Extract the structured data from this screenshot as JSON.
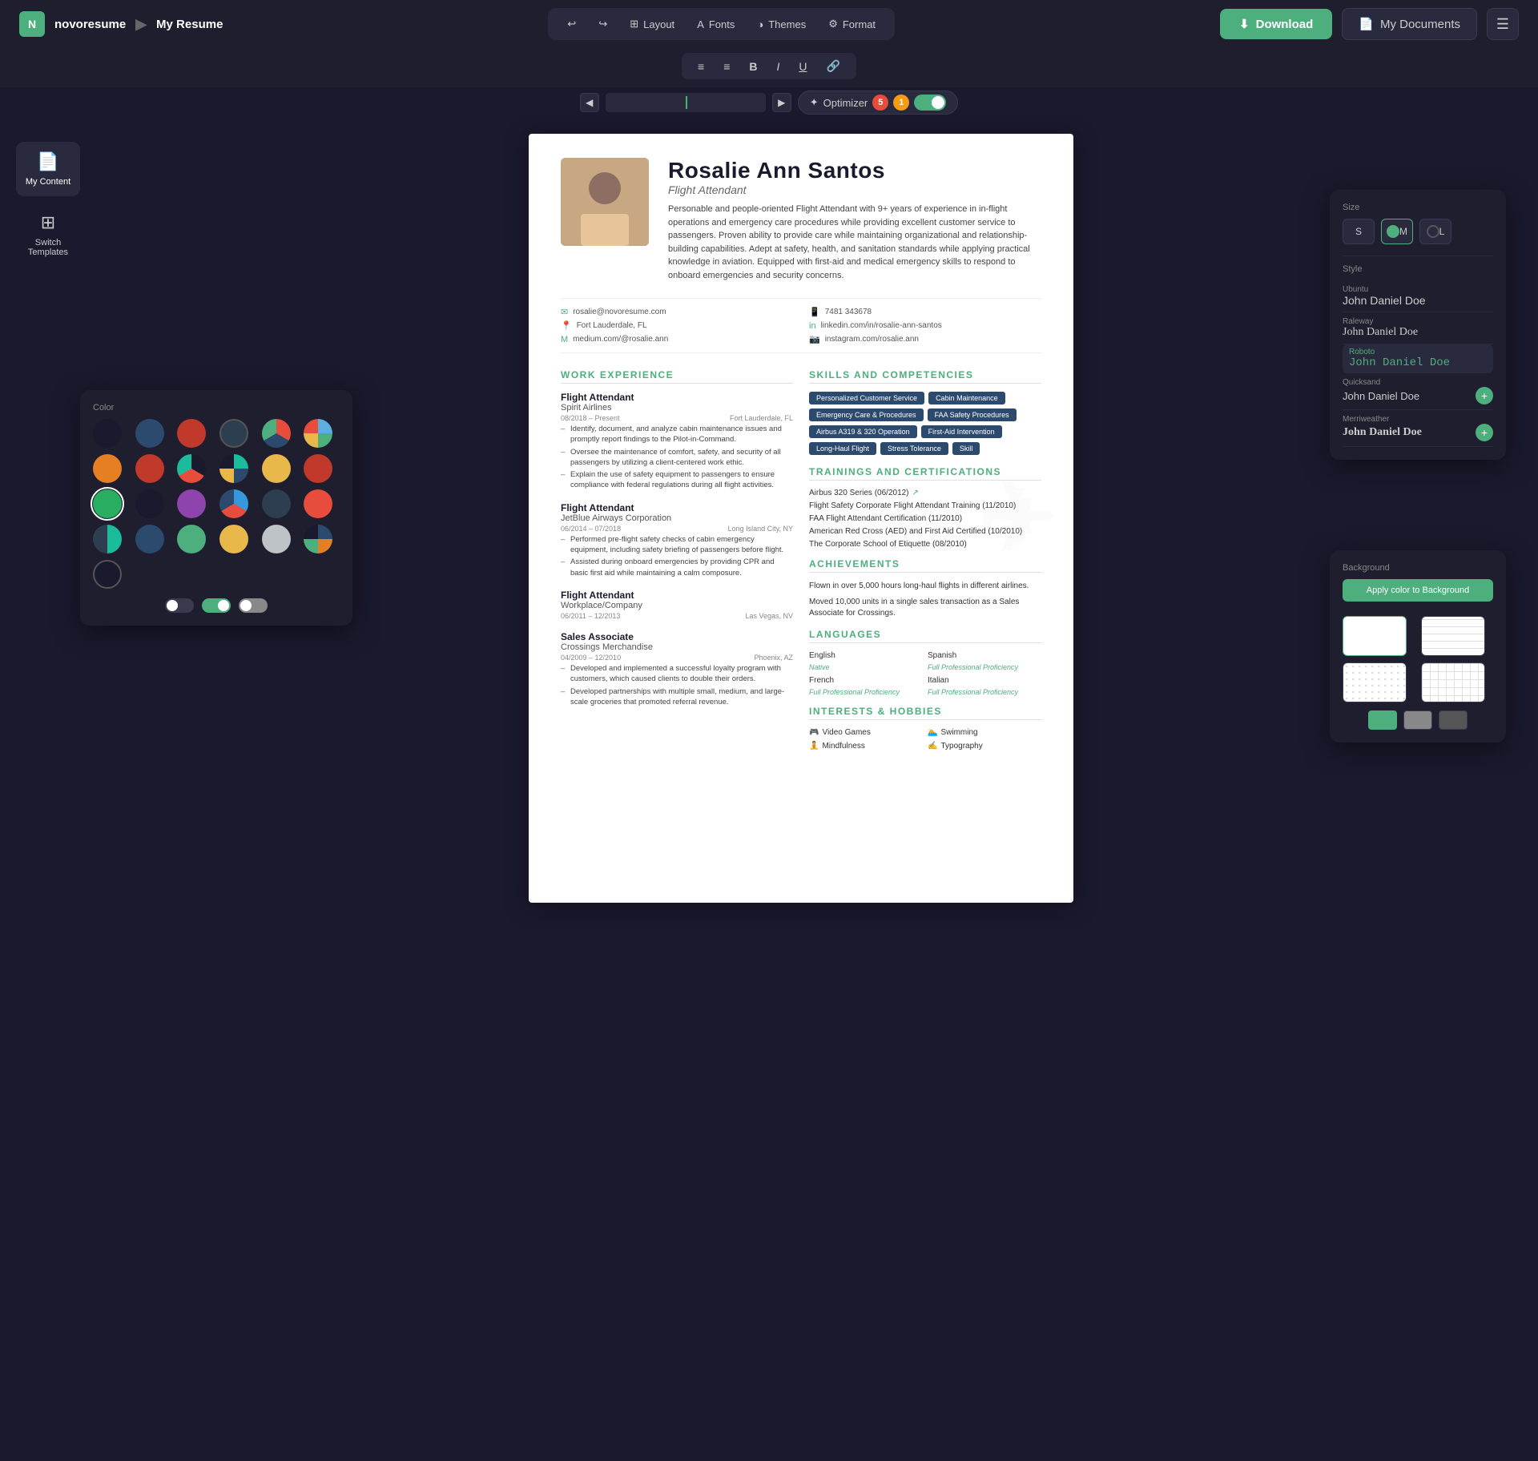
{
  "brand": {
    "logo": "N",
    "app_name": "novoresume",
    "doc_name": "My Resume",
    "sep": "▶"
  },
  "top_nav": {
    "undo_label": "↩",
    "redo_label": "↪",
    "layout_label": "Layout",
    "fonts_label": "Fonts",
    "themes_label": "Themes",
    "format_label": "Format",
    "download_label": "Download",
    "my_docs_label": "My Documents"
  },
  "format_bar": {
    "align_left": "≡",
    "align_center": "≡",
    "bold": "B",
    "italic": "I",
    "underline": "U",
    "link": "🔗"
  },
  "optimizer": {
    "label": "Optimizer",
    "badge_red": "5",
    "badge_orange": "1"
  },
  "sidebar": {
    "items": [
      {
        "id": "my-content",
        "icon": "📄",
        "label": "My Content"
      },
      {
        "id": "switch-templates",
        "icon": "⊞",
        "label": "Switch Templates"
      }
    ]
  },
  "resume": {
    "name": "Rosalie Ann Santos",
    "title": "Flight Attendant",
    "summary": "Personable and people-oriented Flight Attendant with 9+ years of experience in in-flight operations and emergency care procedures while providing excellent customer service to passengers. Proven ability to provide care while maintaining organizational and relationship-building capabilities. Adept at safety, health, and sanitation standards while applying practical knowledge in aviation. Equipped with first-aid and medical emergency skills to respond to onboard emergencies and security concerns.",
    "contact": {
      "email": "rosalie@novoresume.com",
      "phone": "7481 343678",
      "location": "Fort Lauderdale, FL",
      "linkedin": "linkedin.com/in/rosalie-ann-santos",
      "medium": "medium.com/@rosalie.ann",
      "instagram": "instagram.com/rosalie.ann"
    },
    "work_experience": {
      "title": "WORK EXPERIENCE",
      "jobs": [
        {
          "role": "Flight Attendant",
          "company": "Spirit Airlines",
          "dates": "08/2018 – Present",
          "location": "Fort Lauderdale, FL",
          "bullets": [
            "Identify, document, and analyze cabin maintenance issues and promptly report findings to the Pilot-in-Command.",
            "Oversee the maintenance of comfort, safety, and security of all passengers by utilizing a client-centered work ethic.",
            "Explain the use of safety equipment to passengers to ensure compliance with federal regulations during all flight activities."
          ]
        },
        {
          "role": "Flight Attendant",
          "company": "JetBlue Airways Corporation",
          "company_note": "↗",
          "dates": "06/2014 – 07/2018",
          "location": "Long Island City, NY",
          "bullets": [
            "Performed pre-flight safety checks of cabin emergency equipment, including safety briefing of passengers before flight.",
            "Assisted during onboard emergencies by providing CPR and basic first aid while maintaining a calm composure."
          ]
        },
        {
          "role": "Flight Attendant",
          "company": "Workplace/Company",
          "dates": "06/2011 – 12/2013",
          "location": "Las Vegas, NV",
          "bullets": []
        },
        {
          "role": "Sales Associate",
          "company": "Crossings Merchandise",
          "dates": "04/2009 – 12/2010",
          "location": "Phoenix, AZ",
          "bullets": [
            "Developed and implemented a successful loyalty program with customers, which caused clients to double their orders.",
            "Developed partnerships with multiple small, medium, and large-scale groceries that promoted referral revenue."
          ]
        }
      ]
    },
    "skills": {
      "title": "SKILLS AND COMPETENCIES",
      "tags": [
        "Personalized Customer Service",
        "Cabin Maintenance",
        "Emergency Care & Procedures",
        "FAA Safety Procedures",
        "Airbus A319 & 320 Operation",
        "First-Aid Intervention",
        "Long-Haul Flight",
        "Stress Tolerance",
        "Skill"
      ]
    },
    "trainings": {
      "title": "TRAININGS AND CERTIFICATIONS",
      "items": [
        {
          "text": "Airbus 320 Series (06/2012)",
          "link": true
        },
        {
          "text": "Flight Safety Corporate Flight Attendant Training (11/2010)",
          "link": false
        },
        {
          "text": "FAA Flight Attendant Certification (11/2010)",
          "link": false
        },
        {
          "text": "American Red Cross (AED) and First Aid Certified (10/2010)",
          "link": false
        },
        {
          "text": "The Corporate School of Etiquette (08/2010)",
          "link": false
        }
      ]
    },
    "achievements": {
      "title": "ACHIEVEMENTS",
      "items": [
        "Flown in over 5,000 hours long-haul flights in different airlines.",
        "Moved 10,000 units in a single sales transaction as a Sales Associate for Crossings."
      ]
    },
    "languages": {
      "title": "LANGUAGES",
      "items": [
        {
          "lang": "English",
          "level": "Native"
        },
        {
          "lang": "Spanish",
          "level": "Full Professional Proficiency"
        },
        {
          "lang": "French",
          "level": "Full Professional Proficiency"
        },
        {
          "lang": "Italian",
          "level": "Full Professional Proficiency"
        }
      ]
    },
    "interests": {
      "title": "INTERESTS & HOBBIES",
      "items": [
        {
          "icon": "🎮",
          "name": "Video Games"
        },
        {
          "icon": "🏊",
          "name": "Swimming"
        },
        {
          "icon": "🧘",
          "name": "Mindfulness"
        },
        {
          "icon": "✍",
          "name": "Typography"
        }
      ]
    }
  },
  "panel_size_style": {
    "title": "Size",
    "sizes": [
      "S",
      "M",
      "L"
    ],
    "active_size": "M",
    "style_label": "Style",
    "fonts": [
      {
        "name": "Ubuntu",
        "preview": "John Daniel Doe",
        "class": "font-preview-ubuntu"
      },
      {
        "name": "Raleway",
        "preview": "John Daniel Doe",
        "class": "font-preview-raleway"
      },
      {
        "name": "Roboto",
        "preview": "John Daniel Doe",
        "class": "font-preview-roboto",
        "active": true
      },
      {
        "name": "Quicksand",
        "preview": "John Daniel Doe",
        "class": "font-preview-quicksand"
      },
      {
        "name": "Merriweather",
        "preview": "John Daniel Doe",
        "class": "font-preview-merriweather"
      }
    ]
  },
  "panel_color": {
    "title": "Color",
    "colors": [
      "#1a1a2e",
      "#2c4a6e",
      "#e74c3c",
      "#2c3e50",
      "#5dade2",
      "#4caf7d",
      "#e67e22",
      "#e74c3c",
      "#2c4a6e",
      "#1abc9c",
      "#e8b84b",
      "#c0392b",
      "#27ae60",
      "#1a1a2e",
      "#8e44ad",
      "#3498db",
      "#2c3e50",
      "#e74c3c",
      "#1abc9c",
      "#2c4a6e",
      "#4caf7d",
      "#e8b84b",
      "#bdc3c7",
      "#2c4a6e",
      "#1a1a2e"
    ],
    "toggles": [
      "off",
      "on",
      "partial"
    ]
  },
  "panel_background": {
    "title": "Background",
    "apply_label": "Apply color to Background",
    "options": [
      "white",
      "lines",
      "dots",
      "grid"
    ],
    "color_buttons": [
      "#fff",
      "#e8e8e8",
      "#2c4a6e"
    ]
  }
}
